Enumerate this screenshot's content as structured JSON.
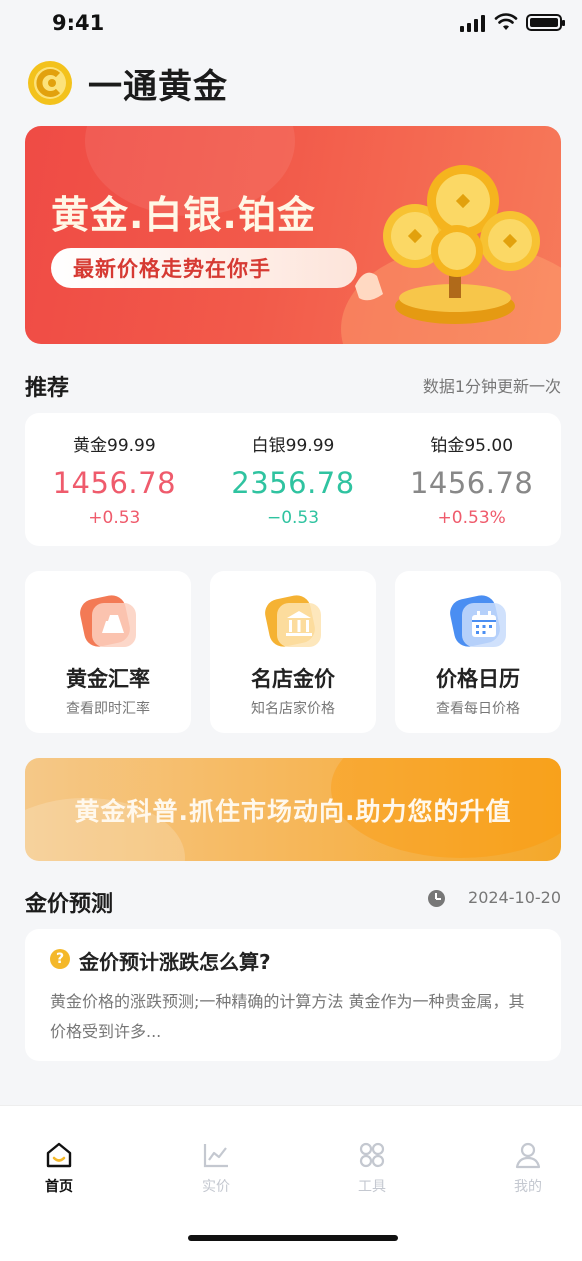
{
  "status_bar": {
    "time": "9:41"
  },
  "app": {
    "name": "一通黄金"
  },
  "banner": {
    "title": "黄金.白银.铂金",
    "subtitle": "最新价格走势在你手"
  },
  "recommend": {
    "title": "推荐",
    "note": "数据1分钟更新一次",
    "items": [
      {
        "name": "黄金99.99",
        "price": "1456.78",
        "change": "+0.53",
        "color": "#ef5b6c"
      },
      {
        "name": "白银99.99",
        "price": "2356.78",
        "change": "−0.53",
        "color": "#2fc3a0"
      },
      {
        "name": "铂金95.00",
        "price": "1456.78",
        "change": "+0.53%",
        "color": "#ef5b6c",
        "price_color": "#888888"
      }
    ]
  },
  "tools": [
    {
      "title": "黄金汇率",
      "subtitle": "查看即时汇率",
      "icon": "gold-bar-icon"
    },
    {
      "title": "名店金价",
      "subtitle": "知名店家价格",
      "icon": "bank-icon"
    },
    {
      "title": "价格日历",
      "subtitle": "查看每日价格",
      "icon": "calendar-icon"
    }
  ],
  "promo": {
    "text": "黄金科普.抓住市场动向.助力您的升值"
  },
  "prediction": {
    "title": "金价预测",
    "date": "2024-10-20",
    "question": "金价预计涨跌怎么算?",
    "body": "黄金价格的涨跌预测;一种精确的计算方法 黄金作为一种贵金属，其价格受到许多..."
  },
  "tabbar": {
    "items": [
      {
        "label": "首页",
        "icon": "home-icon",
        "active": true
      },
      {
        "label": "实价",
        "icon": "chart-icon",
        "active": false
      },
      {
        "label": "工具",
        "icon": "tools-icon",
        "active": false
      },
      {
        "label": "我的",
        "icon": "profile-icon",
        "active": false
      }
    ]
  },
  "colors": {
    "up": "#ef5b6c",
    "down": "#2fc3a0",
    "brand_red": "#ef4b45",
    "gold": "#f4b82a"
  }
}
